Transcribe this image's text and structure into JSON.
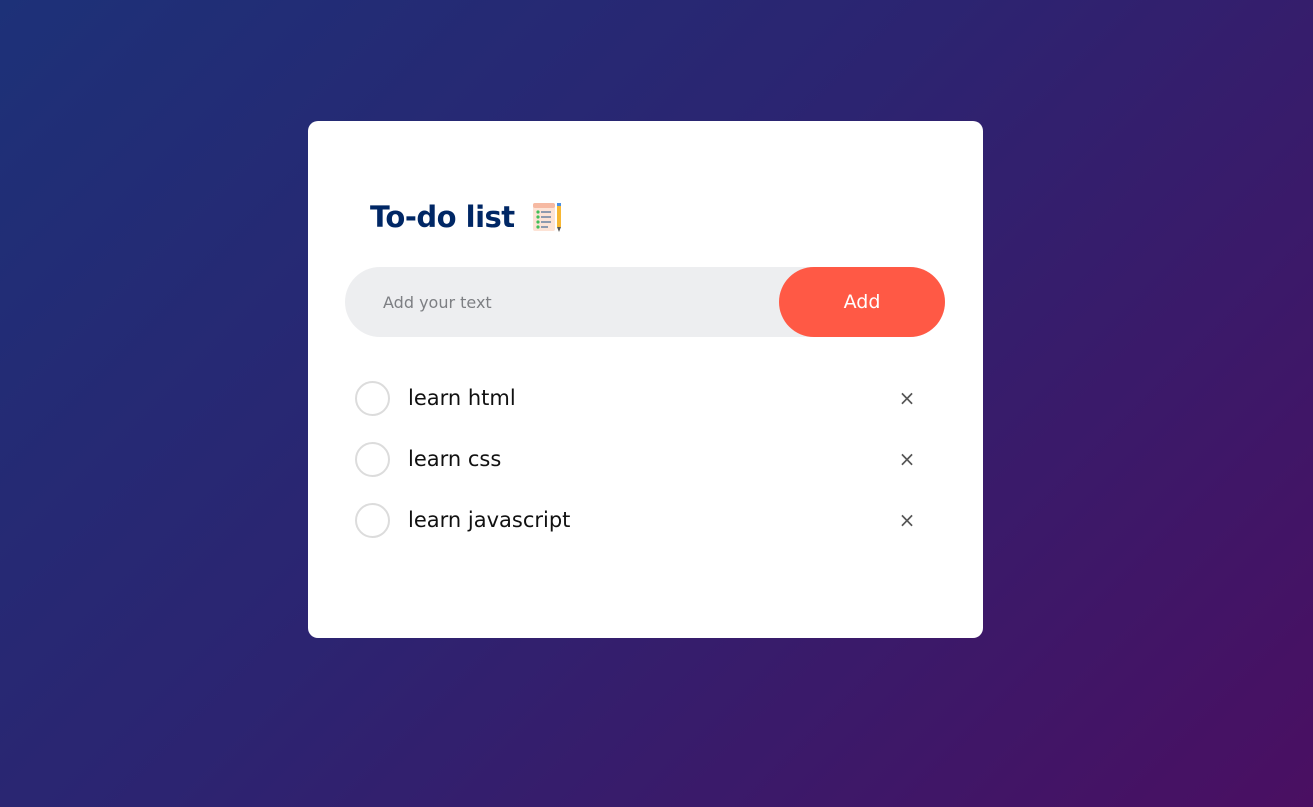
{
  "app": {
    "title": "To-do list",
    "title_icon": "notepad-pencil-icon"
  },
  "input": {
    "value": "",
    "placeholder": "Add your text"
  },
  "add_button": {
    "label": "Add"
  },
  "tasks": [
    {
      "label": "learn html",
      "checked": false,
      "remove_icon": "×"
    },
    {
      "label": "learn css",
      "checked": false,
      "remove_icon": "×"
    },
    {
      "label": "learn javascript",
      "checked": false,
      "remove_icon": "×"
    }
  ],
  "colors": {
    "accent": "#ff5945",
    "title": "#002765",
    "input_bg": "#edeef0",
    "background_start": "#1d3178",
    "background_end": "#4a0f62"
  }
}
